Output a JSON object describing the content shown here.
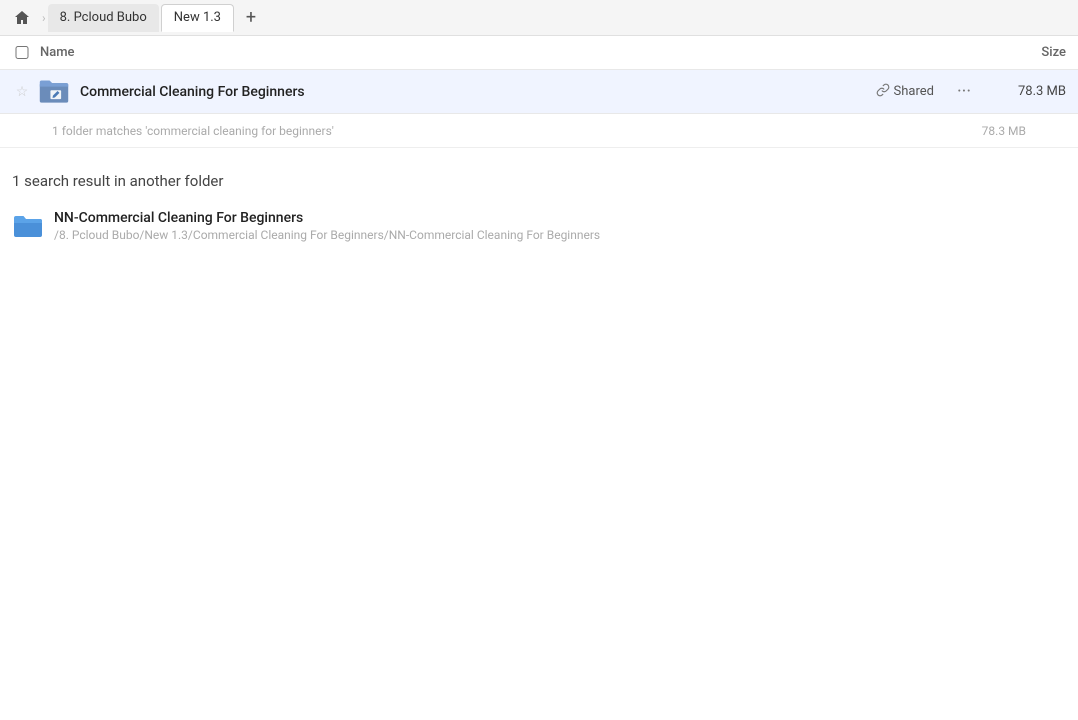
{
  "topbar": {
    "home_icon": "⌂",
    "tabs": [
      {
        "label": "8. Pcloud Bubo",
        "active": false
      },
      {
        "label": "New 1.3",
        "active": true
      }
    ],
    "add_tab_icon": "+"
  },
  "columns": {
    "name_label": "Name",
    "size_label": "Size"
  },
  "file_row": {
    "name": "Commercial Cleaning For Beginners",
    "shared_label": "Shared",
    "size": "78.3 MB",
    "star_icon": "☆",
    "more_icon": "···",
    "link_icon": "🔗"
  },
  "match_row": {
    "text": "1 folder matches 'commercial cleaning for beginners'",
    "size": "78.3 MB"
  },
  "section": {
    "header": "1 search result in another folder"
  },
  "results": [
    {
      "name": "NN-Commercial Cleaning For Beginners",
      "path": "/8. Pcloud Bubo/New 1.3/Commercial Cleaning For Beginners/NN-Commercial Cleaning For Beginners"
    }
  ]
}
